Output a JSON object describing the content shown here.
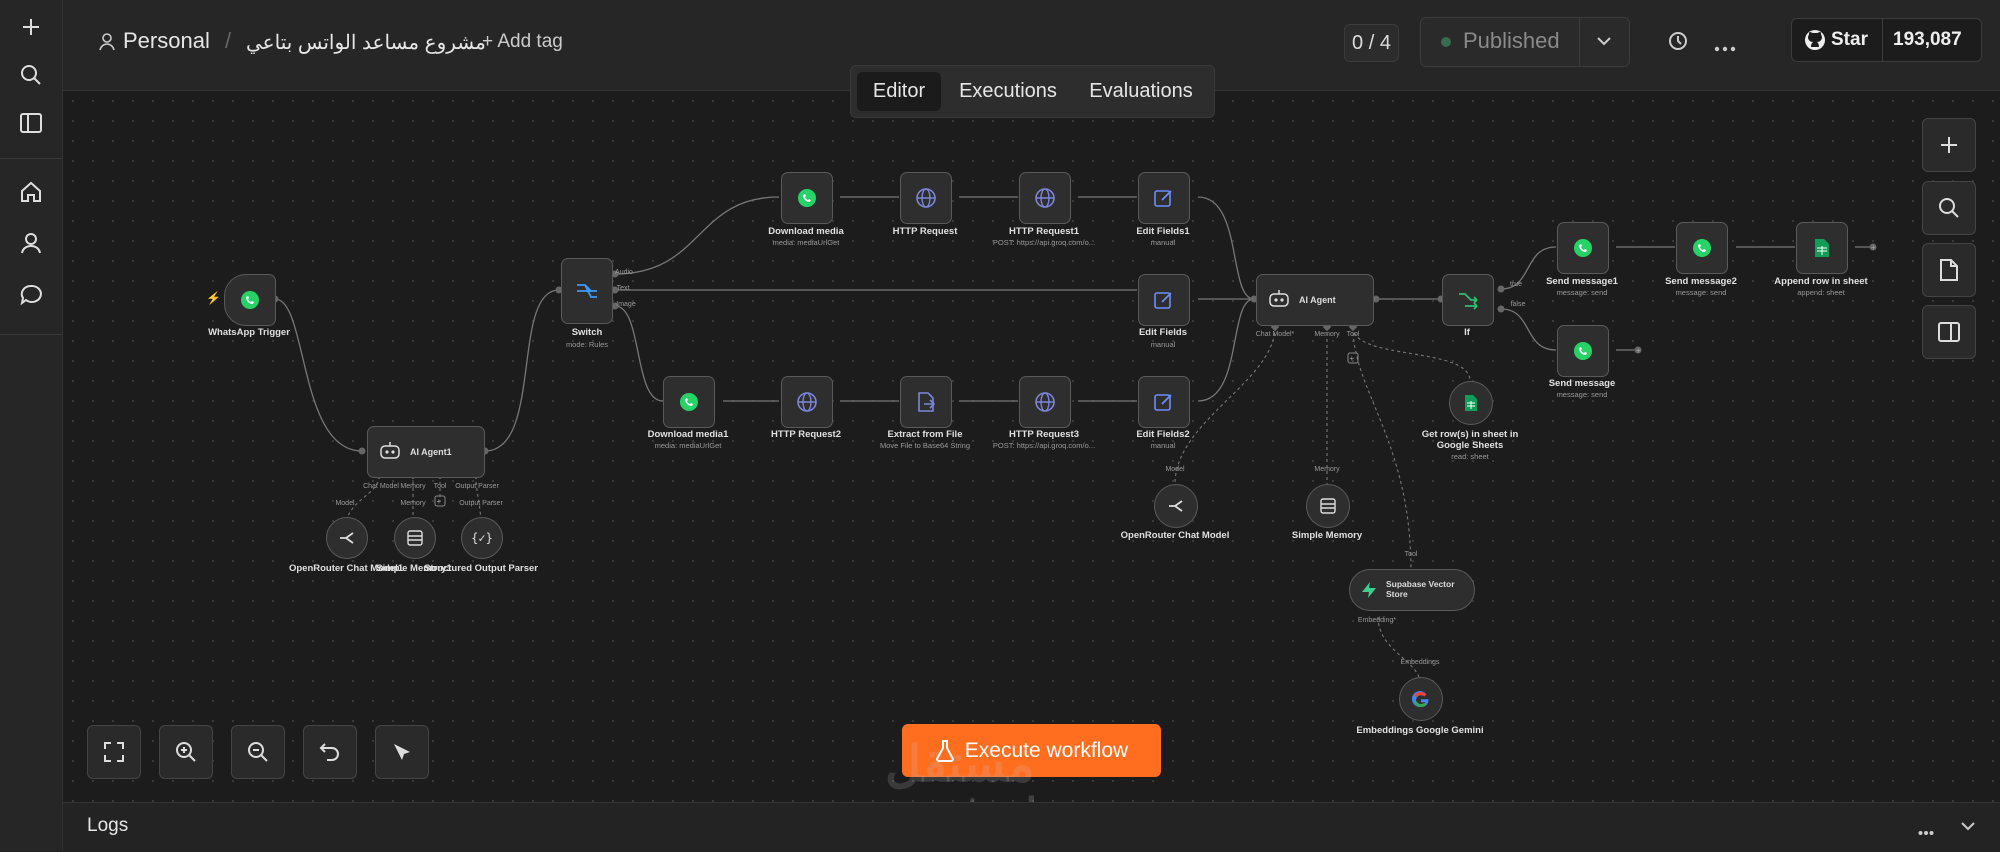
{
  "header": {
    "project_label": "Personal",
    "workflow_name": "مشروع مساعد الواتس بتاعي",
    "add_tag": "+ Add tag",
    "counter": "0 / 4",
    "published": "Published",
    "star_label": "Star",
    "star_count": "193,087"
  },
  "tabs": [
    "Editor",
    "Executions",
    "Evaluations"
  ],
  "execute_label": "Execute workflow",
  "logs_label": "Logs",
  "watermark": "mostaql.com",
  "watermark_ar": "مستقل",
  "nodes": {
    "trigger": {
      "label": "WhatsApp Trigger"
    },
    "agent1": {
      "label": "AI Agent1",
      "p1": "Chat Model",
      "p2": "Memory",
      "p3": "Tool",
      "p4": "Output Parser"
    },
    "or1": {
      "label": "OpenRouter Chat Model1",
      "port": "Model"
    },
    "mem1": {
      "label": "Simple Memory1",
      "port": "Memory"
    },
    "sop": {
      "label": "Structured Output Parser",
      "port": "Output Parser"
    },
    "switch": {
      "label": "Switch",
      "sub": "mode: Rules",
      "o1": "Audio",
      "o2": "Text",
      "o3": "Image"
    },
    "dlmedia": {
      "label": "Download media",
      "sub": "media: mediaUrlGet"
    },
    "http": {
      "label": "HTTP Request"
    },
    "http1": {
      "label": "HTTP Request1",
      "sub": "POST: https://api.groq.com/o..."
    },
    "edit1": {
      "label": "Edit Fields1",
      "sub": "manual"
    },
    "edit": {
      "label": "Edit Fields",
      "sub": "manual"
    },
    "dlmedia1": {
      "label": "Download media1",
      "sub": "media: mediaUrlGet"
    },
    "http2": {
      "label": "HTTP Request2"
    },
    "extract": {
      "label": "Extract from File",
      "sub": "Move File to Base64 String"
    },
    "http3": {
      "label": "HTTP Request3",
      "sub": "POST: https://api.groq.com/o..."
    },
    "edit2": {
      "label": "Edit Fields2",
      "sub": "manual"
    },
    "agent": {
      "label": "AI Agent",
      "p1": "Chat Model*",
      "p2": "Memory",
      "p3": "Tool"
    },
    "or": {
      "label": "OpenRouter Chat Model",
      "port": "Model"
    },
    "mem": {
      "label": "Simple Memory",
      "port": "Memory"
    },
    "getrows": {
      "label": "Get row(s) in sheet in Google Sheets",
      "sub": "read: sheet"
    },
    "supa": {
      "label": "Supabase Vector Store",
      "port": "Tool",
      "p1": "Embedding*"
    },
    "emb": {
      "label": "Embeddings Google Gemini",
      "port": "Embeddings"
    },
    "if": {
      "label": "If",
      "o1": "true",
      "o2": "false"
    },
    "send1": {
      "label": "Send message1",
      "sub": "message: send"
    },
    "send2": {
      "label": "Send message2",
      "sub": "message: send"
    },
    "append": {
      "label": "Append row in sheet",
      "sub": "append: sheet"
    },
    "send": {
      "label": "Send message",
      "sub": "message: send"
    }
  },
  "colors": {
    "accent": "#ff6d1f",
    "whatsapp": "#25d366",
    "sheets": "#0f9d58",
    "globe": "#7b86d9",
    "edit": "#6c8dfa",
    "switch": "#3b9bf5",
    "if": "#2fbf71",
    "supabase": "#3ecf8e"
  }
}
